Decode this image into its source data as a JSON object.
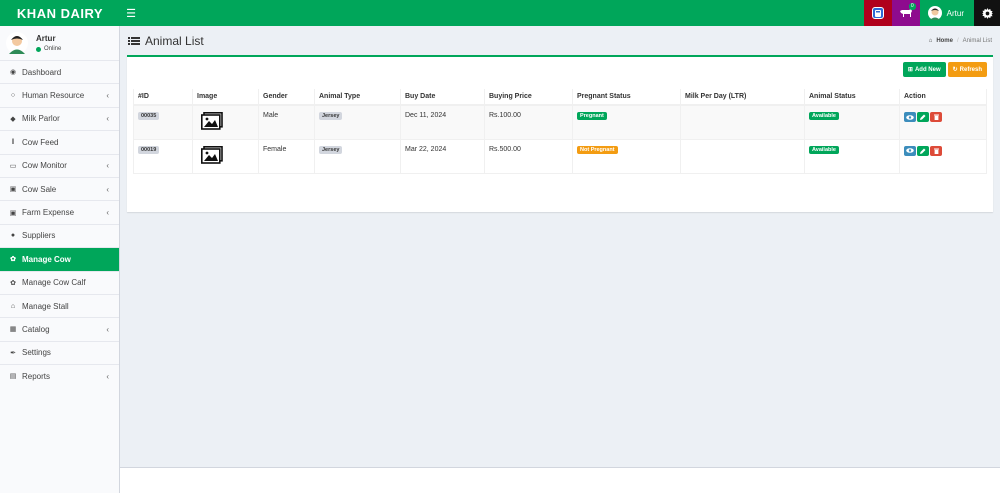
{
  "app": {
    "logo_text": "KHAN DAIRY"
  },
  "header": {
    "notif_count": "0",
    "user_name": "Artur"
  },
  "sidebar": {
    "user": {
      "name": "Artur",
      "status": "Online"
    },
    "items": [
      {
        "label": "Dashboard",
        "icon": "dashboard-icon"
      },
      {
        "label": "Human Resource",
        "icon": "user-icon"
      },
      {
        "label": "Milk Parlor",
        "icon": "droplet-icon"
      },
      {
        "label": "Cow Feed",
        "icon": "cutlery-icon"
      },
      {
        "label": "Cow Monitor",
        "icon": "monitor-icon"
      },
      {
        "label": "Cow Sale",
        "icon": "money-icon"
      },
      {
        "label": "Farm Expense",
        "icon": "money-icon"
      },
      {
        "label": "Suppliers",
        "icon": "person-icon"
      },
      {
        "label": "Manage Cow",
        "icon": "paw-icon"
      },
      {
        "label": "Manage Cow Calf",
        "icon": "paw-icon"
      },
      {
        "label": "Manage Stall",
        "icon": "home-icon"
      },
      {
        "label": "Catalog",
        "icon": "grid-icon"
      },
      {
        "label": "Settings",
        "icon": "wrench-icon"
      },
      {
        "label": "Reports",
        "icon": "bar-chart-icon"
      }
    ]
  },
  "page": {
    "title": "Animal List",
    "breadcrumb": {
      "home": "Home",
      "current": "Animal List"
    }
  },
  "toolbar": {
    "add_label": "Add New",
    "refresh_label": "Refresh"
  },
  "table": {
    "headers": [
      "#ID",
      "Image",
      "Gender",
      "Animal Type",
      "Buy Date",
      "Buying Price",
      "Pregnant Status",
      "Milk Per Day (LTR)",
      "Animal Status",
      "Action"
    ],
    "rows": [
      {
        "id": "00035",
        "gender": "Male",
        "type": "Jersey",
        "buy_date": "Dec 11, 2024",
        "price": "Rs.100.00",
        "pregnant": "Pregnant",
        "milk": "",
        "status": "Available"
      },
      {
        "id": "00019",
        "gender": "Female",
        "type": "Jersey",
        "buy_date": "Mar 22, 2024",
        "price": "Rs.500.00",
        "pregnant": "Not Pregnant",
        "milk": "",
        "status": "Available"
      }
    ]
  },
  "colors": {
    "brand_green": "#00a65a",
    "warning_orange": "#f39c12",
    "danger_red": "#dd4b39",
    "info_blue": "#3c8dbc"
  }
}
